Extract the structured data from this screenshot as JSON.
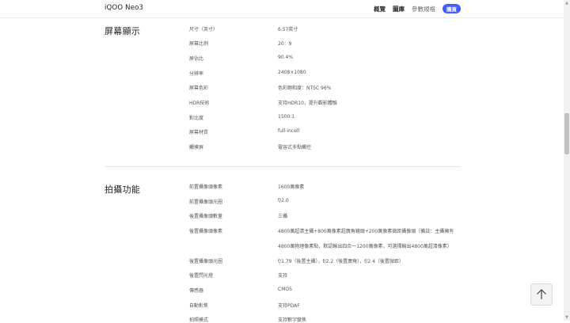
{
  "header": {
    "brand": "iQOO Neo3",
    "nav": {
      "overview": "概覽",
      "gallery": "圖庫",
      "specs": "參數規格"
    },
    "buy_label": "購買"
  },
  "display": {
    "title": "屏幕顯示",
    "rows": [
      {
        "label": "尺寸（英寸）",
        "value": "6.57英寸"
      },
      {
        "label": "屏幕比例",
        "value": "20：9"
      },
      {
        "label": "屏佔比",
        "value": "90.4%"
      },
      {
        "label": "分辨率",
        "value": "2408×1080"
      },
      {
        "label": "屏幕色彩",
        "value": "色彩飽和度：NTSC 96%"
      },
      {
        "label": "HDR技術",
        "value": "支持HDR10，提升觀影體驗"
      },
      {
        "label": "對比度",
        "value": "1500:1"
      },
      {
        "label": "屏幕材質",
        "value": "full-incell"
      },
      {
        "label": "觸摸屏",
        "value": "電容式多點觸控"
      }
    ]
  },
  "camera": {
    "title": "拍攝功能",
    "rows": [
      {
        "label": "前置攝像頭像素",
        "value": "1600萬像素"
      },
      {
        "label": "前置攝像頭光圈",
        "value": "f/2.0"
      },
      {
        "label": "後置攝像頭數量",
        "value": "三攝"
      },
      {
        "label": "後置攝像頭像素",
        "value": "4800萬超清主攝+800萬像素超廣角鏡頭+200萬像素微距攝像頭（備註：主攝擁有",
        "value2": "4800萬物理像素點，默認輸出四合一1200萬像素，可選擇輸出4800萬超清像素）"
      },
      {
        "label": "後置攝像頭光圈",
        "value": "f/1.79（後置主攝），f/2.2（後置廣角），f/2.4（後置微距）"
      },
      {
        "label": "後置閃光燈",
        "value": "支持"
      },
      {
        "label": "傳感器",
        "value": "CMOS"
      },
      {
        "label": "自動對焦",
        "value": "支持PDAF"
      },
      {
        "label": "拍照模式",
        "value": "支持數字變焦"
      }
    ]
  },
  "back_to_top_icon": "arrow-up-icon"
}
